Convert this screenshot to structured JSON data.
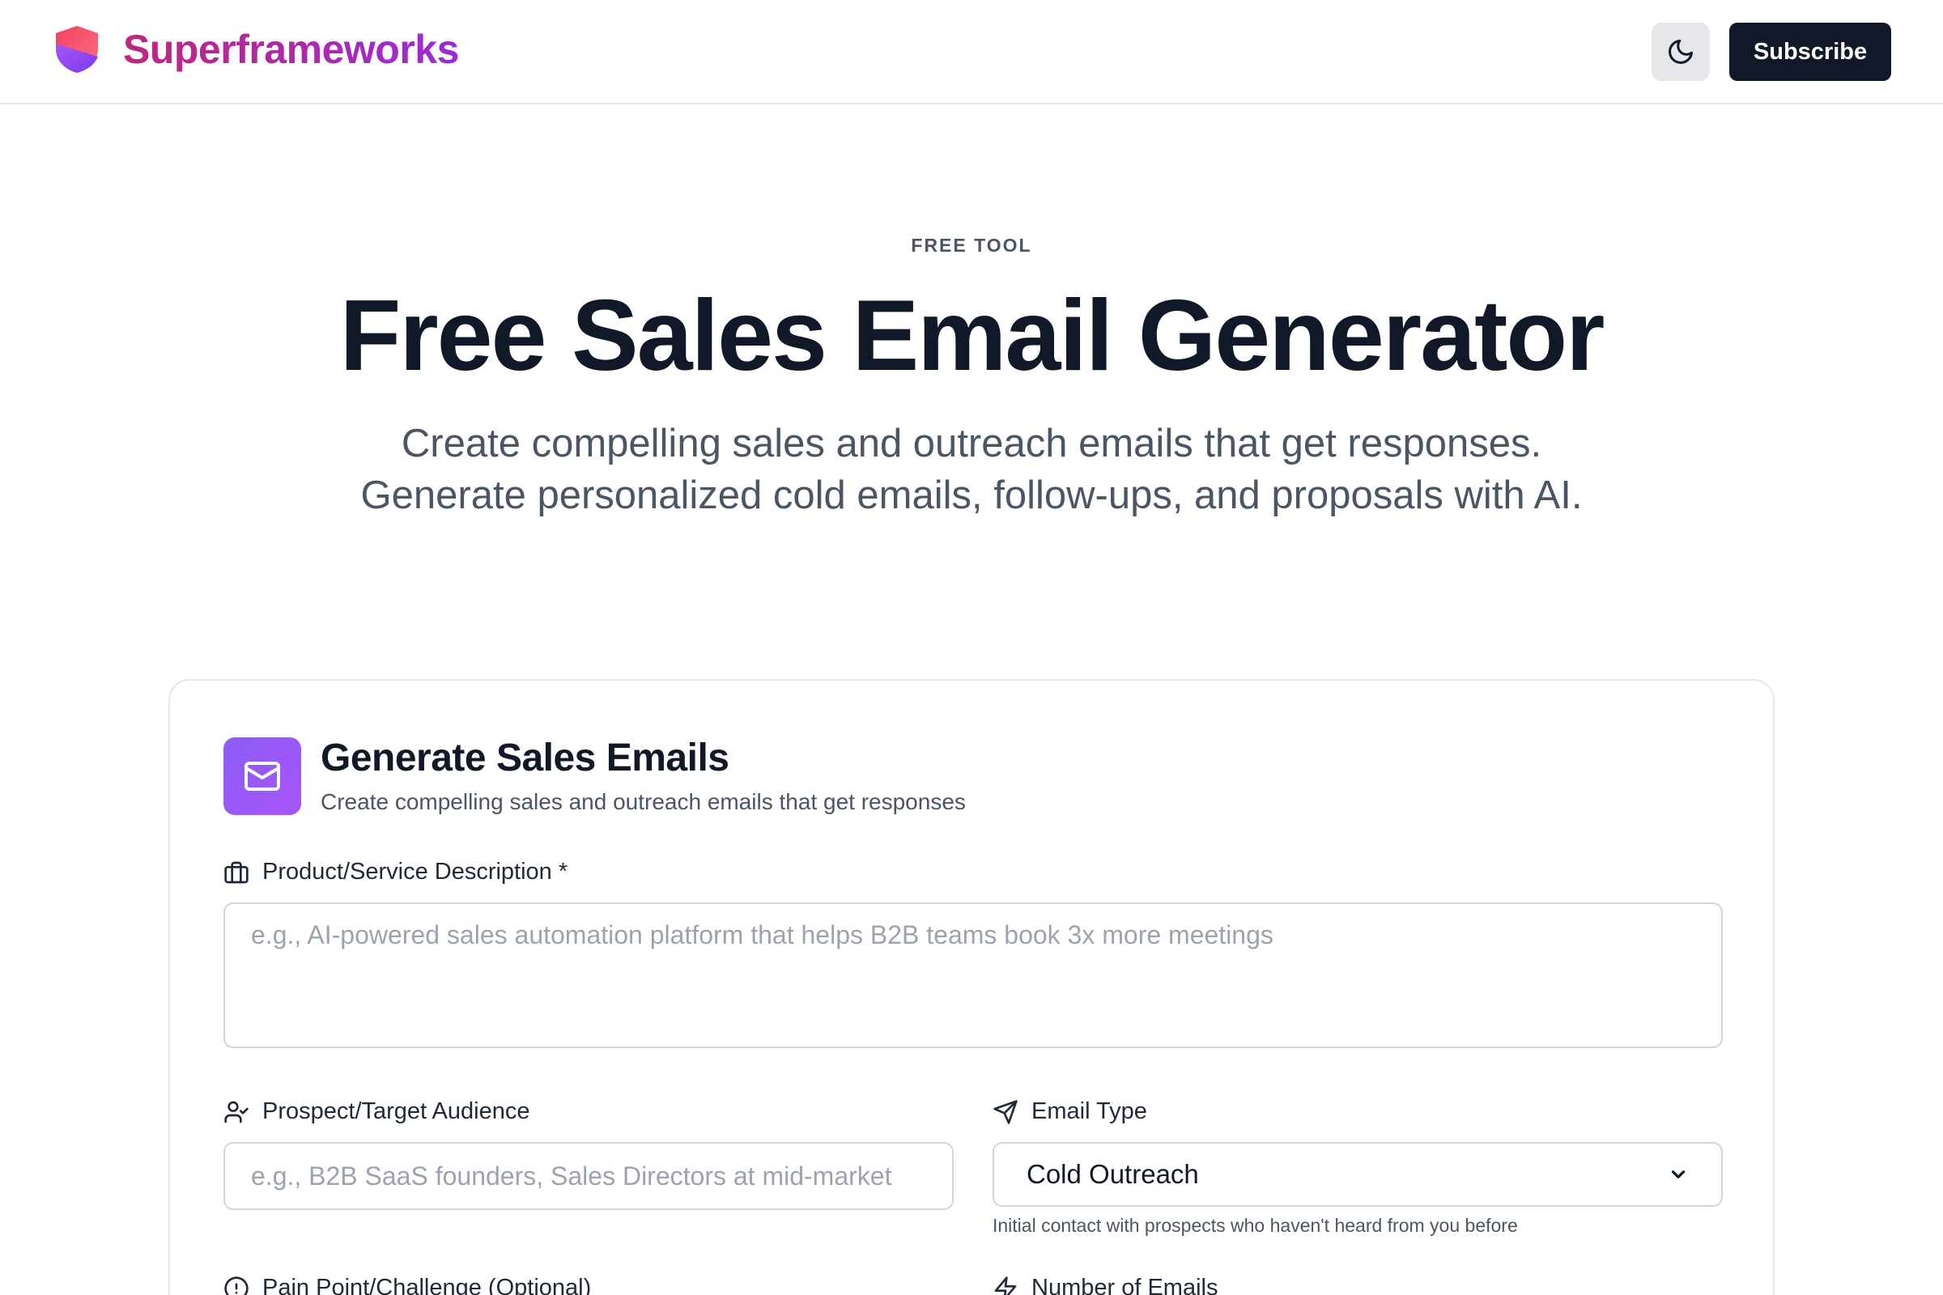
{
  "header": {
    "brand_name": "Superframeworks",
    "subscribe_label": "Subscribe"
  },
  "hero": {
    "eyebrow": "FREE TOOL",
    "title": "Free Sales Email Generator",
    "subtitle": "Create compelling sales and outreach emails that get responses. Generate personalized cold emails, follow-ups, and proposals with AI."
  },
  "card": {
    "title": "Generate Sales Emails",
    "subtitle": "Create compelling sales and outreach emails that get responses",
    "product": {
      "label": "Product/Service Description *",
      "placeholder": "e.g., AI-powered sales automation platform that helps B2B teams book 3x more meetings",
      "value": ""
    },
    "prospect": {
      "label": "Prospect/Target Audience",
      "placeholder": "e.g., B2B SaaS founders, Sales Directors at mid-market",
      "value": ""
    },
    "email_type": {
      "label": "Email Type",
      "selected": "Cold Outreach",
      "hint": "Initial contact with prospects who haven't heard from you before"
    },
    "pain_point": {
      "label": "Pain Point/Challenge (Optional)"
    },
    "num_emails": {
      "label": "Number of Emails"
    }
  },
  "colors": {
    "brand_gradient_start": "#c0267a",
    "brand_gradient_end": "#9b2bd8",
    "primary_dark": "#111827",
    "accent_purple": "#8b5cf6"
  },
  "icons": {
    "logo": "shield-icon",
    "theme": "moon-icon",
    "card": "mail-icon",
    "product": "briefcase-icon",
    "prospect": "user-check-icon",
    "email_type": "send-icon",
    "pain_point": "alert-circle-icon",
    "num_emails": "zap-icon"
  }
}
